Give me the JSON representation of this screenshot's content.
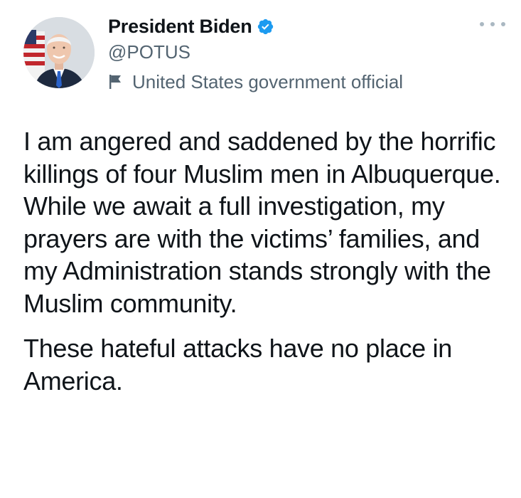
{
  "author": {
    "display_name": "President Biden",
    "handle": "@POTUS",
    "label": "United States government official",
    "verified": true,
    "avatar_icon": "portrait-photo"
  },
  "menu": {
    "icon": "more-horizontal-icon"
  },
  "tweet": {
    "paragraphs": [
      "I am angered and saddened by the horrific killings of four Muslim men in Albuquerque. While we await a full investigation, my prayers are with the victims’ families, and my Administration stands strongly with the Muslim community.",
      "These hateful attacks have no place in America."
    ]
  },
  "colors": {
    "text": "#0f1419",
    "secondary_text": "#536471",
    "verified_blue": "#1d9bf0",
    "more_dots": "#aab8c2"
  }
}
